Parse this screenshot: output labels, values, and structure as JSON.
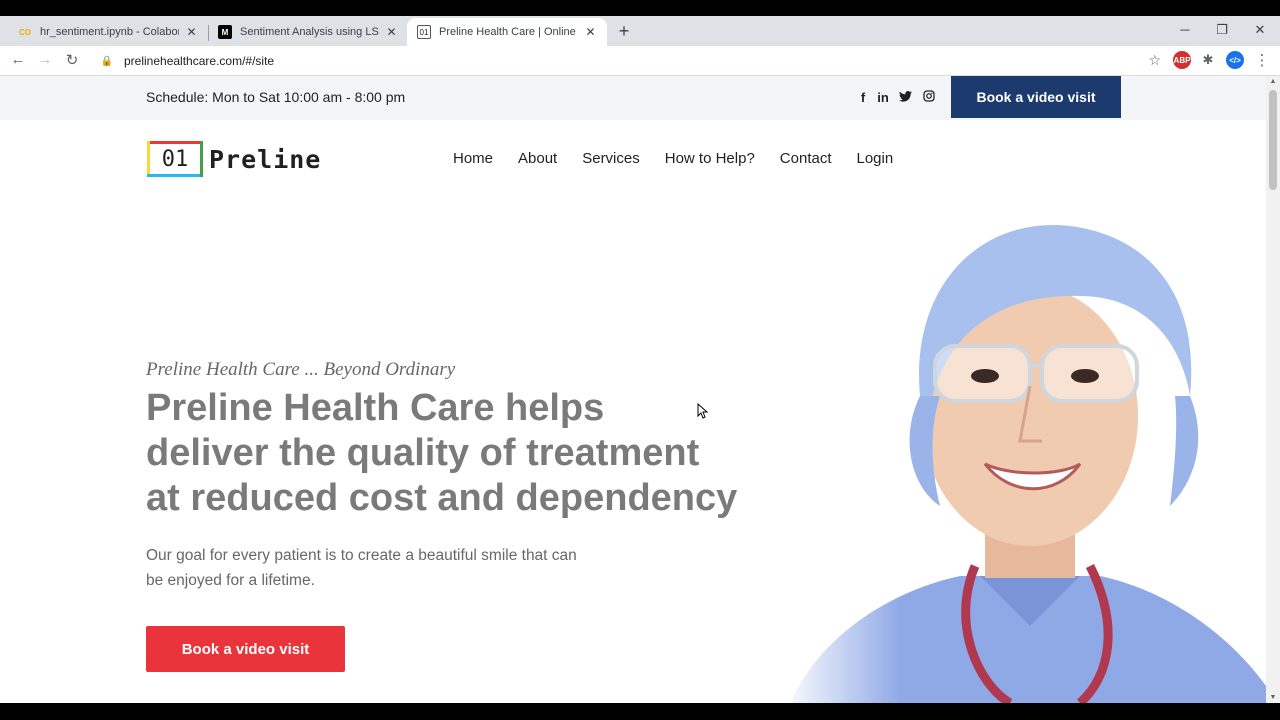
{
  "browser": {
    "tabs": [
      {
        "title": "hr_sentiment.ipynb - Colaboratory",
        "favicon": "CO",
        "active": false
      },
      {
        "title": "Sentiment Analysis using LSTM. I",
        "favicon": "M",
        "active": false
      },
      {
        "title": "Preline Health Care | Online Video",
        "favicon": "01",
        "active": true
      }
    ],
    "url": "prelinehealthcare.com/#/site",
    "extensions": [
      "ABP",
      "puzzle-icon",
      "</>"
    ]
  },
  "topbar": {
    "schedule": "Schedule: Mon to Sat 10:00 am - 8:00 pm",
    "social": [
      {
        "name": "facebook-icon",
        "glyph": "f"
      },
      {
        "name": "linkedin-icon",
        "glyph": "in"
      },
      {
        "name": "twitter-icon",
        "glyph": "🐦"
      },
      {
        "name": "instagram-icon",
        "glyph": "◎"
      }
    ],
    "cta": "Book a video visit"
  },
  "header": {
    "logo_number": "01",
    "logo_text": "Preline",
    "nav": [
      "Home",
      "About",
      "Services",
      "How to Help?",
      "Contact",
      "Login"
    ]
  },
  "hero": {
    "tagline": "Preline Health Care ... Beyond Ordinary",
    "headline_lines": [
      "Preline Health Care helps",
      "deliver the quality of treatment",
      "at reduced cost and dependency"
    ],
    "description_lines": [
      "Our goal for every patient is to create a beautiful smile that can",
      "be enjoyed for a lifetime."
    ],
    "cta": "Book a video visit"
  },
  "colors": {
    "navy": "#1d3a6e",
    "red": "#e8343a",
    "scrub_blue": "#8fa8e6"
  }
}
